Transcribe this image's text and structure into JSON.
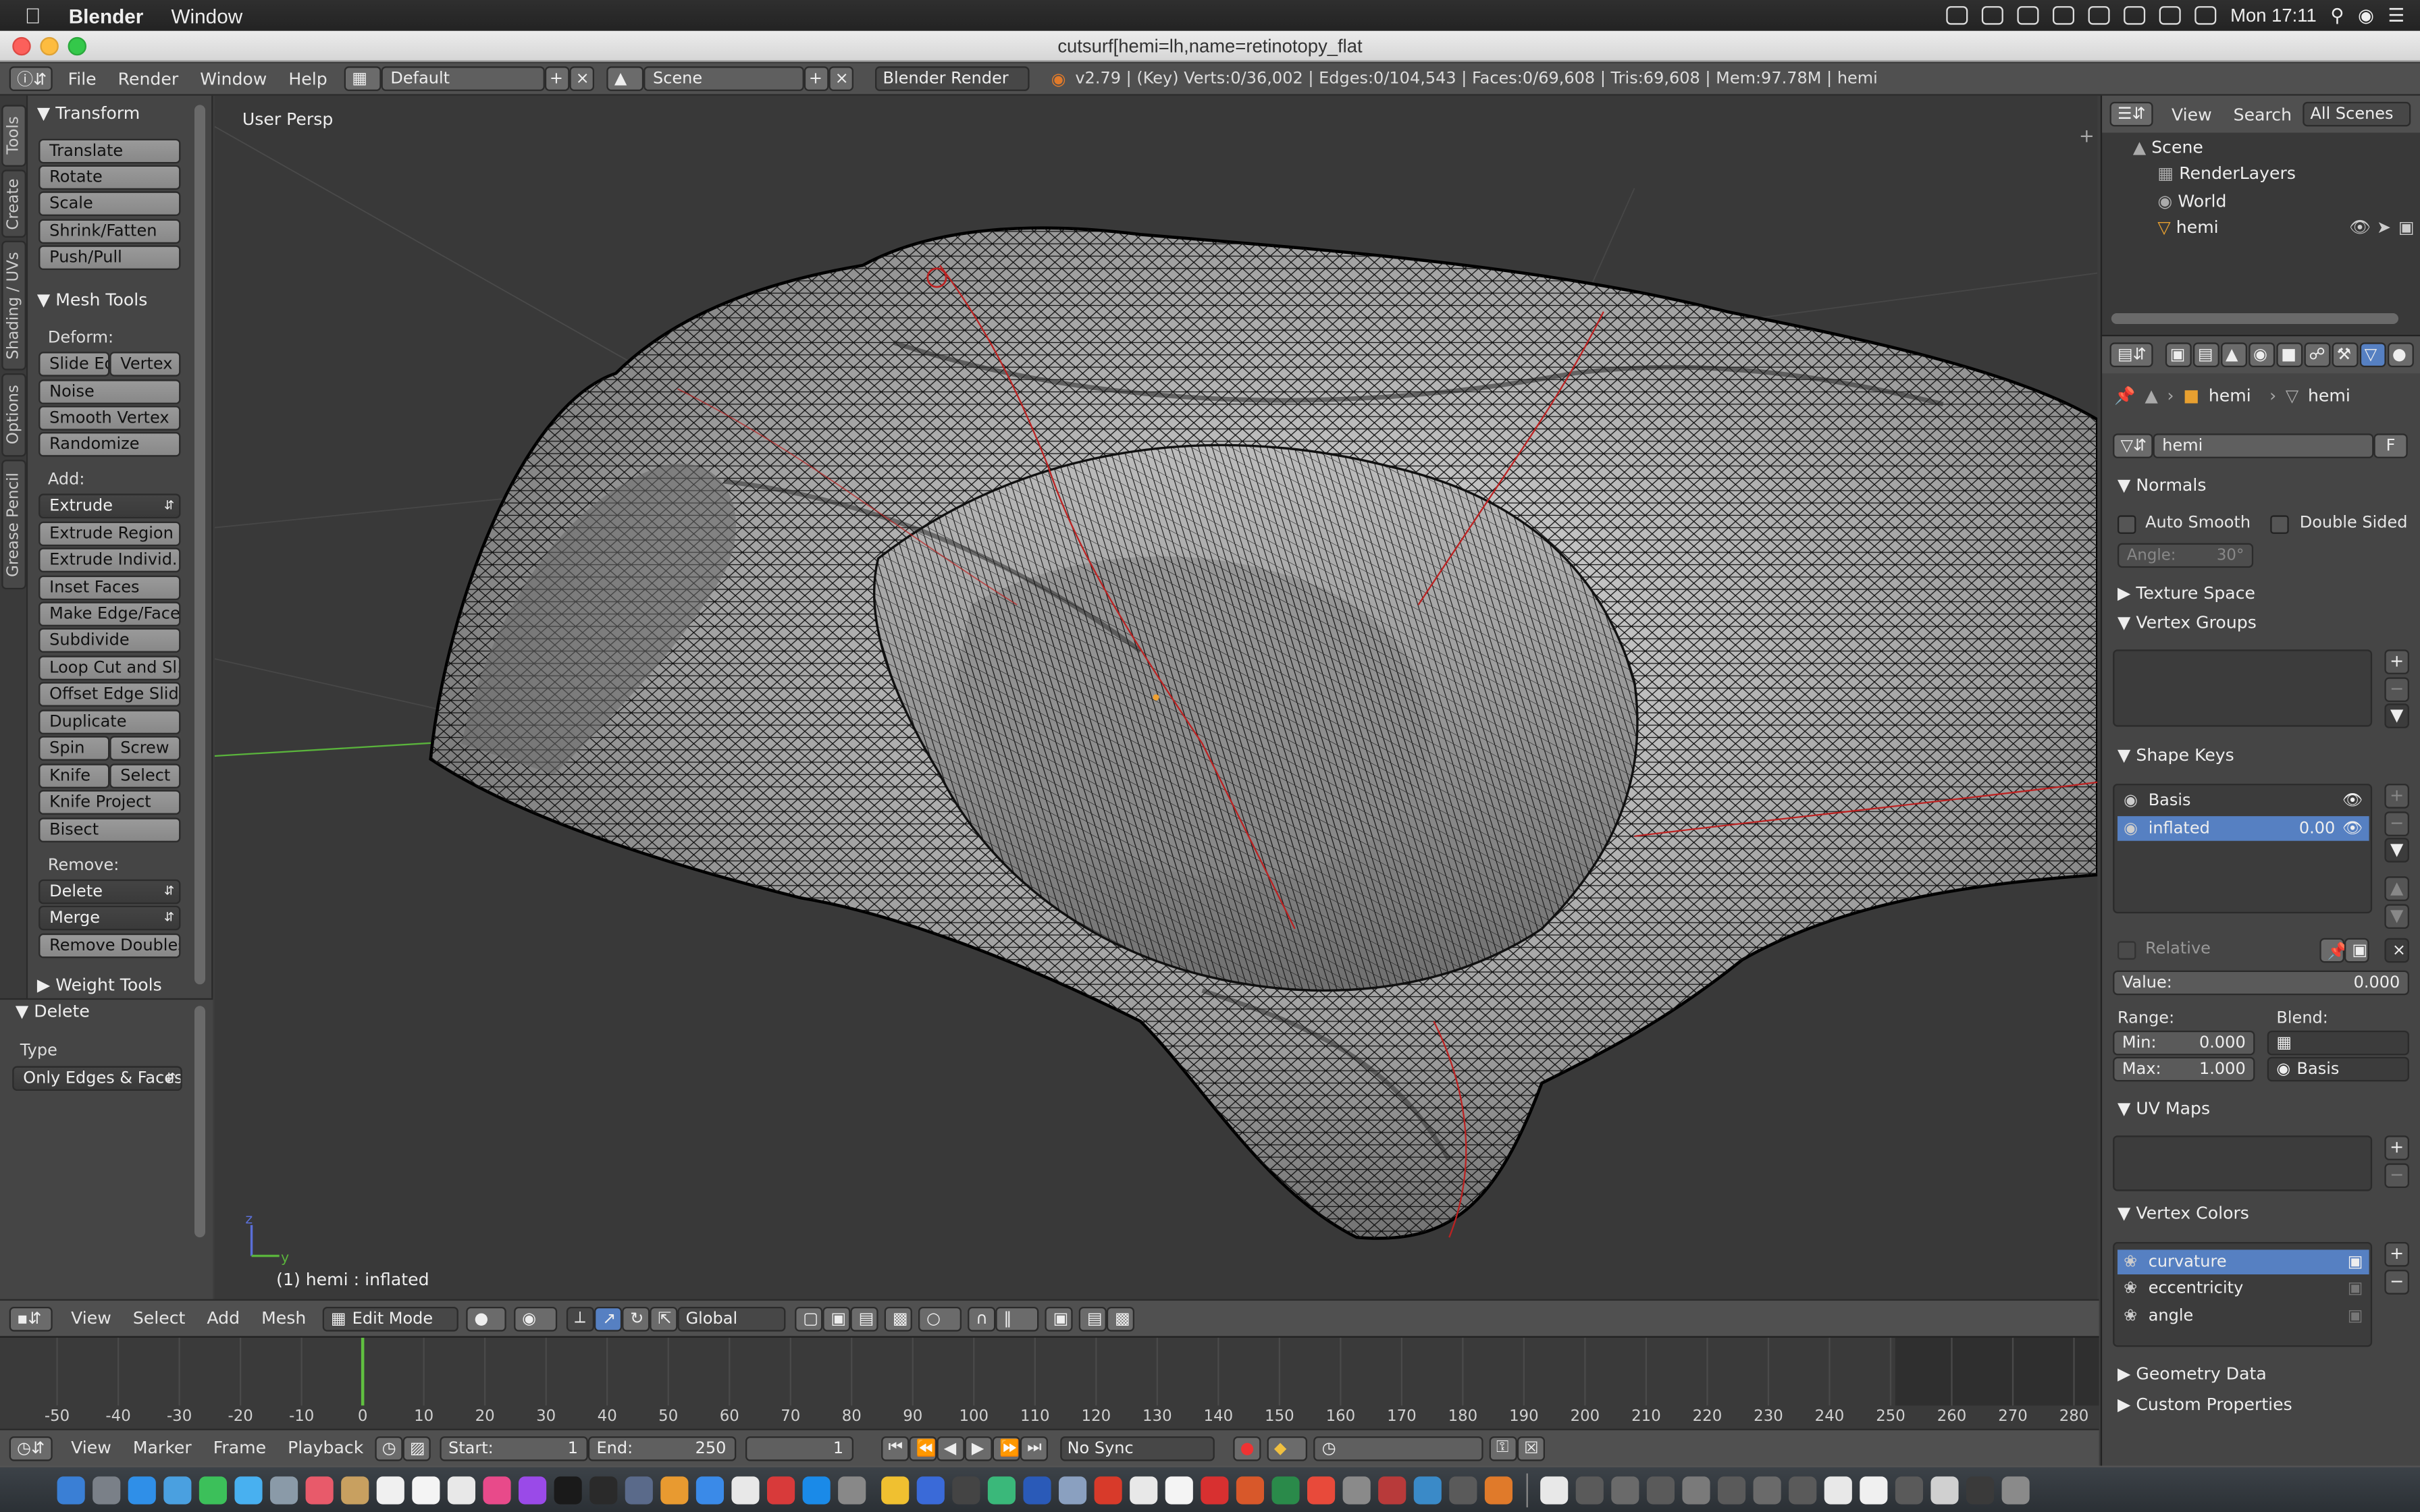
{
  "menubar": {
    "app": "Blender",
    "items": [
      "Window"
    ],
    "clock": "Mon 17:11"
  },
  "window": {
    "title": "cutsurf[hemi=lh,name=retinotopy_flat"
  },
  "topbar": {
    "menus": [
      "File",
      "Render",
      "Window",
      "Help"
    ],
    "screen_layout": "Default",
    "scene": "Scene",
    "engine": "Blender Render",
    "stats": "v2.79 | (Key) Verts:0/36,002 | Edges:0/104,543 | Faces:0/69,608 | Tris:69,608 | Mem:97.78M | hemi"
  },
  "tool_tabs": [
    "Tools",
    "Create",
    "Shading / UVs",
    "Options",
    "Grease Pencil"
  ],
  "tools": {
    "transform_header": "Transform",
    "transform": [
      "Translate",
      "Rotate",
      "Scale",
      "Shrink/Fatten",
      "Push/Pull"
    ],
    "mesh_tools_header": "Mesh Tools",
    "deform_label": "Deform:",
    "slide_edge": "Slide Ed",
    "vertex": "Vertex",
    "deform": [
      "Noise",
      "Smooth Vertex",
      "Randomize"
    ],
    "add_label": "Add:",
    "extrude": "Extrude",
    "add": [
      "Extrude Region",
      "Extrude Individ...",
      "Inset Faces",
      "Make Edge/Face",
      "Subdivide",
      "Loop Cut and Sl...",
      "Offset Edge Slide",
      "Duplicate"
    ],
    "spin": "Spin",
    "screw": "Screw",
    "knife": "Knife",
    "select": "Select",
    "knife_project": "Knife Project",
    "bisect": "Bisect",
    "remove_label": "Remove:",
    "delete": "Delete",
    "merge": "Merge",
    "remove_doubles": "Remove Doubles",
    "weight_tools_header": "Weight Tools"
  },
  "operator": {
    "header": "Delete",
    "type_label": "Type",
    "type_value": "Only Edges & Faces"
  },
  "viewport": {
    "view_label": "User Persp",
    "object_label": "(1) hemi : inflated"
  },
  "view3d_header": {
    "menus": [
      "View",
      "Select",
      "Add",
      "Mesh"
    ],
    "mode": "Edit Mode",
    "orientation": "Global"
  },
  "timeline": {
    "ticks": [
      "-50",
      "-40",
      "-30",
      "-20",
      "-10",
      "0",
      "10",
      "20",
      "30",
      "40",
      "50",
      "60",
      "70",
      "80",
      "90",
      "100",
      "110",
      "120",
      "130",
      "140",
      "150",
      "160",
      "170",
      "180",
      "190",
      "200",
      "210",
      "220",
      "230",
      "240",
      "250",
      "260",
      "270",
      "280"
    ],
    "current_frame_value": 0,
    "menus": [
      "View",
      "Marker",
      "Frame",
      "Playback"
    ],
    "start_label": "Start:",
    "start_value": "1",
    "end_label": "End:",
    "end_value": "250",
    "frame_value": "1",
    "sync": "No Sync"
  },
  "outliner": {
    "menus": [
      "View",
      "Search"
    ],
    "filter": "All Scenes",
    "tree": [
      "Scene",
      "RenderLayers",
      "World",
      "hemi"
    ]
  },
  "properties": {
    "breadcrumb": [
      "hemi",
      "hemi"
    ],
    "datablock": "hemi",
    "fake_user": "F",
    "normals_header": "Normals",
    "auto_smooth": "Auto Smooth",
    "double_sided": "Double Sided",
    "angle_label": "Angle:",
    "angle_value": "30°",
    "texture_space": "Texture Space",
    "vertex_groups": "Vertex Groups",
    "shape_keys_header": "Shape Keys",
    "shape_keys": [
      {
        "name": "Basis",
        "value": ""
      },
      {
        "name": "inflated",
        "value": "0.00"
      }
    ],
    "relative": "Relative",
    "value_label": "Value:",
    "value": "0.000",
    "range_label": "Range:",
    "blend_label": "Blend:",
    "min_label": "Min:",
    "min_value": "0.000",
    "max_label": "Max:",
    "max_value": "1.000",
    "blend_value": "Basis",
    "uv_maps": "UV Maps",
    "vertex_colors_header": "Vertex Colors",
    "vertex_colors": [
      "curvature",
      "eccentricity",
      "angle"
    ],
    "geometry_data": "Geometry Data",
    "custom_properties": "Custom Properties"
  },
  "colors": {
    "accent": "#5680c2",
    "x_axis": "#c83c3c",
    "y_axis": "#5ab43c",
    "current_frame": "#60c040"
  }
}
